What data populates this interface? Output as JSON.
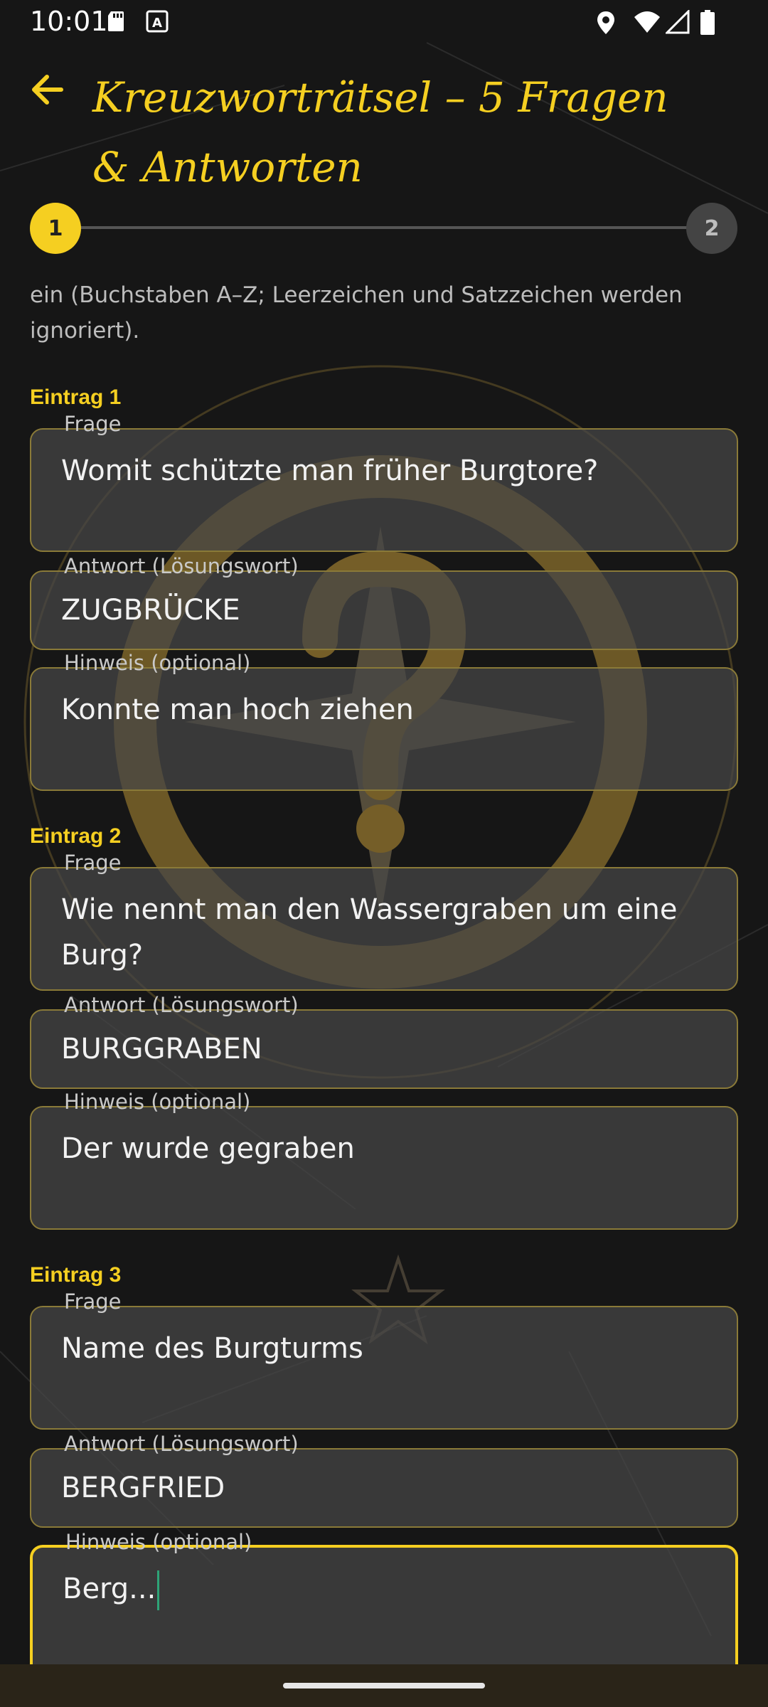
{
  "status_bar": {
    "time": "10:01"
  },
  "header": {
    "title": "Kreuzworträtsel – 5 Fragen & Antworten"
  },
  "stepper": {
    "steps": [
      "1",
      "2"
    ],
    "active": "1"
  },
  "instructions": "ein (Buchstaben A–Z; Leerzeichen und Satzzeichen werden ignoriert).",
  "entries": [
    {
      "label": "Eintrag 1",
      "question_label": "Frage",
      "question": "Womit schützte man früher Burgtore?",
      "answer_label": "Antwort (Lösungswort)",
      "answer": "ZUGBRÜCKE",
      "hint_label": "Hinweis (optional)",
      "hint": "Konnte man hoch ziehen"
    },
    {
      "label": "Eintrag 2",
      "question_label": "Frage",
      "question": "Wie nennt man den Wassergraben um eine Burg?",
      "answer_label": "Antwort (Lösungswort)",
      "answer": "BURGGRABEN",
      "hint_label": "Hinweis (optional)",
      "hint": "Der wurde gegraben"
    },
    {
      "label": "Eintrag 3",
      "question_label": "Frage",
      "question": "Name des Burgturms",
      "answer_label": "Antwort (Lösungswort)",
      "answer": "BERGFRIED",
      "hint_label": "Hinweis (optional)",
      "hint": "Berg..."
    }
  ],
  "colors": {
    "accent": "#f5cf21",
    "background": "#161616",
    "field": "#464646"
  }
}
